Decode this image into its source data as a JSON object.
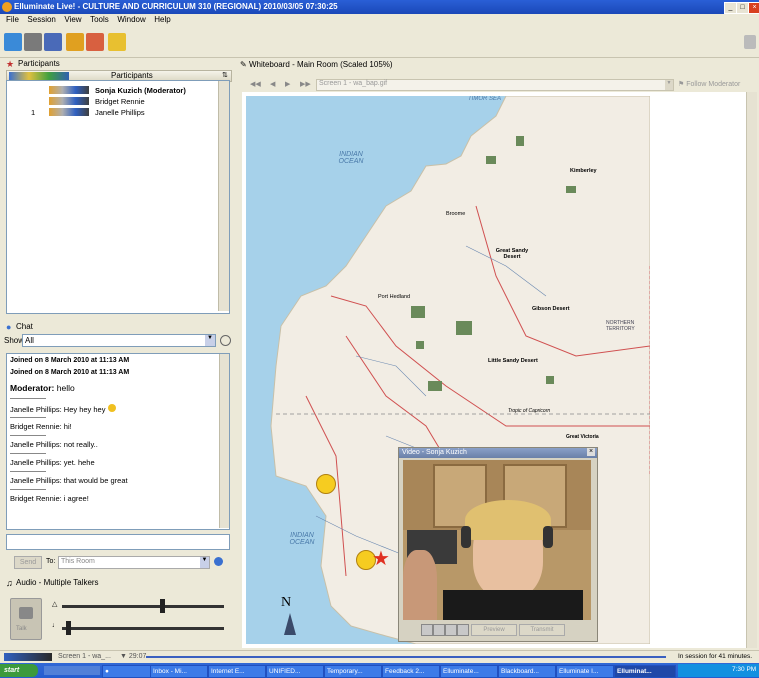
{
  "window": {
    "title": "Elluminate Live! - CULTURE AND CURRICULUM 310 (REGIONAL) 2010/03/05 07:30:25",
    "min": "_",
    "max": "□",
    "close": "×"
  },
  "menu": [
    "File",
    "Session",
    "View",
    "Tools",
    "Window",
    "Help"
  ],
  "participants": {
    "header": "Participants",
    "column": "Participants",
    "rows": [
      {
        "num": "",
        "name": "Sonja Kuzich (Moderator)",
        "bold": true
      },
      {
        "num": "",
        "name": "Bridget Rennie",
        "bold": false
      },
      {
        "num": "1",
        "name": "Janelle Phillips",
        "bold": false
      }
    ]
  },
  "chat": {
    "header": "Chat",
    "show_label": "Show",
    "show_value": "All",
    "lines": [
      {
        "text": "Joined on 8 March 2010 at 11:13 AM",
        "bold": true
      },
      {
        "text": "Joined on 8 March 2010 at 11:13 AM",
        "bold": true
      },
      {
        "text": "Moderator: hello",
        "bold": false,
        "big": true
      },
      {
        "text": "Janelle Phillips: Hey hey hey",
        "bold": false,
        "smiley": true
      },
      {
        "text": "Bridget Rennie: hi!",
        "bold": false
      },
      {
        "text": "Janelle Phillips: not really..",
        "bold": false
      },
      {
        "text": "Janelle Phillips: yet. hehe",
        "bold": false
      },
      {
        "text": "Janelle Phillips: that would be great",
        "bold": false
      },
      {
        "text": "Bridget Rennie: i agree!",
        "bold": false
      }
    ],
    "send_label": "Send",
    "to_label": "To:",
    "to_value": "This Room"
  },
  "audio": {
    "header": "Audio - Multiple Talkers",
    "talk_label": "Talk"
  },
  "whiteboard": {
    "header": "Whiteboard - Main Room (Scaled 105%)",
    "screen_field": "Screen 1 - wa_bap.gif",
    "follow_label": "Follow Moderator"
  },
  "map": {
    "labels": [
      "TIMOR SEA",
      "INDIAN OCEAN",
      "INDIAN OCEAN",
      "Great Sandy Desert",
      "Gibson Desert",
      "Little Sandy Desert",
      "Kimberley",
      "Port Hedland",
      "Broome",
      "Tropic of Capricorn",
      "NORTHERN TERRITORY",
      "Great Victoria"
    ],
    "compass": "N"
  },
  "video": {
    "title": "Video - Sonja Kuzich",
    "close": "×",
    "btn1": "Preview",
    "btn2": "Transmit"
  },
  "statusbar": {
    "screen": "Screen 1 - wa_...",
    "time": "29:07",
    "session": "In session for 41 minutes."
  },
  "taskbar": {
    "start": "start",
    "tasks": [
      "Inbox - Mi...",
      "Internet E...",
      "UNIFIED...",
      "Temporary...",
      "Feedback 2...",
      "Elluminate...",
      "Blackboard...",
      "Elluminate I...",
      "Elluminat..."
    ],
    "clock": "7:30 PM"
  },
  "colors": {
    "accent": "#2a5fd6",
    "panel": "#ece9d8",
    "sea": "#a6d1ea",
    "land": "#f2ede4"
  }
}
